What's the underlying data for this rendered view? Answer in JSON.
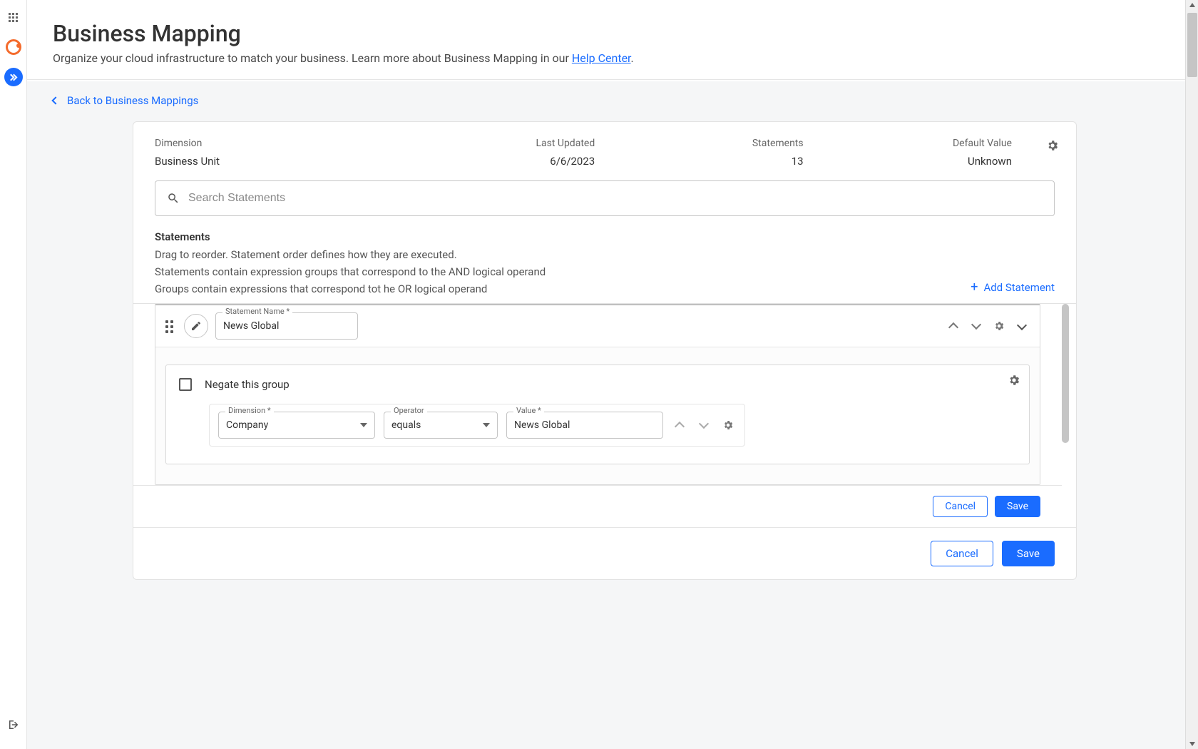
{
  "header": {
    "title": "Business Mapping",
    "subtitle_prefix": "Organize your cloud infrastructure to match your business. Learn more about Business Mapping in our ",
    "help_link": "Help Center",
    "subtitle_suffix": "."
  },
  "back_link": "Back to Business Mappings",
  "summary": {
    "dimension_label": "Dimension",
    "dimension_value": "Business Unit",
    "last_updated_label": "Last Updated",
    "last_updated_value": "6/6/2023",
    "statements_label": "Statements",
    "statements_value": "13",
    "default_label": "Default Value",
    "default_value": "Unknown"
  },
  "search": {
    "placeholder": "Search Statements"
  },
  "statements_section": {
    "title": "Statements",
    "line1": "Drag to reorder. Statement order defines how they are executed.",
    "line2": "Statements contain expression groups that correspond to the AND logical operand",
    "line3": "Groups contain expressions that correspond tot he OR logical operand",
    "add_label": "Add Statement"
  },
  "statement": {
    "name_label": "Statement Name",
    "name_value": "News Global",
    "group": {
      "negate_label": "Negate this group",
      "expression": {
        "dimension_label": "Dimension",
        "dimension_value": "Company",
        "operator_label": "Operator",
        "operator_value": "equals",
        "value_label": "Value",
        "value_value": "News Global"
      }
    }
  },
  "actions": {
    "cancel": "Cancel",
    "save": "Save"
  }
}
